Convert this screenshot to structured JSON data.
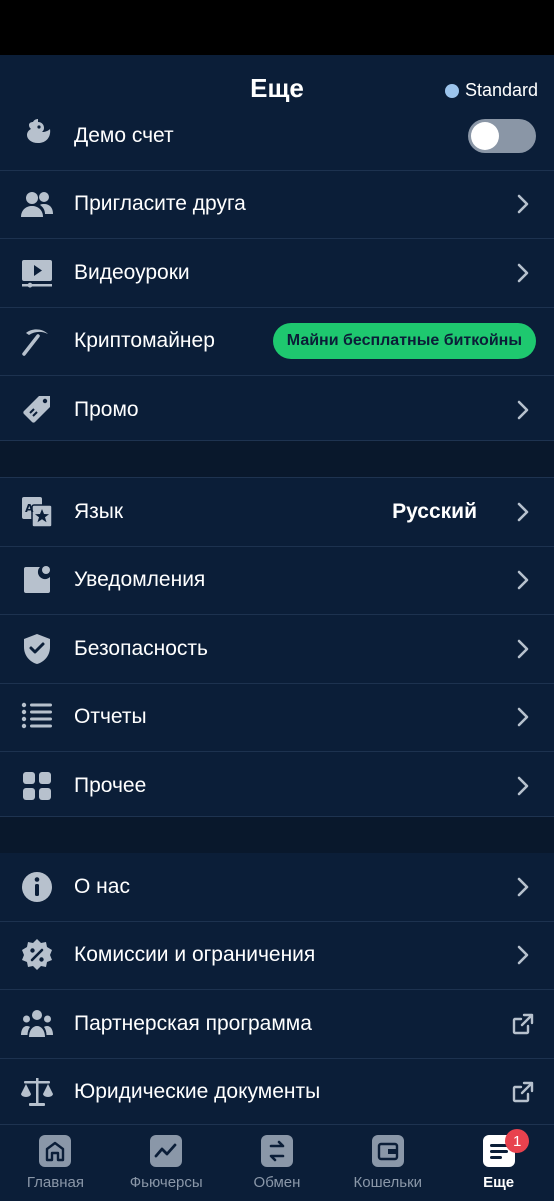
{
  "header": {
    "title": "Еще",
    "account_label": "Standard",
    "account_dot_color": "#9cc4ec"
  },
  "section1": {
    "demo": {
      "label": "Демо счет",
      "icon": "duck-icon",
      "toggle_on": false
    },
    "invite": {
      "label": "Пригласите друга",
      "icon": "users-icon"
    },
    "video": {
      "label": "Видеоуроки",
      "icon": "video-icon"
    },
    "miner": {
      "label": "Криптомайнер",
      "icon": "pickaxe-icon",
      "pill": "Майни бесплатные биткойны"
    },
    "promo": {
      "label": "Промо",
      "icon": "tag-icon"
    }
  },
  "section2": {
    "language": {
      "label": "Язык",
      "value": "Русский",
      "icon": "translate-icon"
    },
    "notifications": {
      "label": "Уведомления",
      "icon": "notification-icon"
    },
    "security": {
      "label": "Безопасность",
      "icon": "shield-icon"
    },
    "reports": {
      "label": "Отчеты",
      "icon": "list-icon"
    },
    "other": {
      "label": "Прочее",
      "icon": "grid-icon"
    }
  },
  "section3": {
    "about": {
      "label": "О нас",
      "icon": "info-icon"
    },
    "fees": {
      "label": "Комиссии и ограничения",
      "icon": "percent-badge-icon"
    },
    "partner": {
      "label": "Партнерская программа",
      "icon": "group-icon"
    },
    "legal": {
      "label": "Юридические документы",
      "icon": "scales-icon"
    }
  },
  "tabbar": {
    "home": "Главная",
    "futures": "Фьючерсы",
    "exchange": "Обмен",
    "wallets": "Кошельки",
    "more": "Еще",
    "more_badge": "1"
  },
  "colors": {
    "background": "#0b1e38",
    "accent_green": "#1ec86f",
    "badge_red": "#e8424e",
    "icon_gray": "#b7c1cd"
  }
}
